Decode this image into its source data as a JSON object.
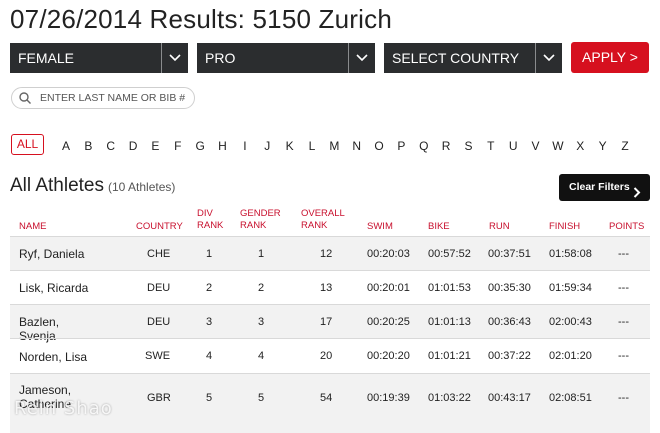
{
  "page_title": "07/26/2014 Results: 5150 Zurich",
  "filters": {
    "gender": "FEMALE",
    "division": "PRO",
    "country": "SELECT COUNTRY",
    "apply_label": "APPLY >"
  },
  "search": {
    "placeholder": "ENTER LAST NAME OR BIB #"
  },
  "alphabet": {
    "all_label": "ALL",
    "letters": [
      "A",
      "B",
      "C",
      "D",
      "E",
      "F",
      "G",
      "H",
      "I",
      "J",
      "K",
      "L",
      "M",
      "N",
      "O",
      "P",
      "Q",
      "R",
      "S",
      "T",
      "U",
      "V",
      "W",
      "X",
      "Y",
      "Z"
    ]
  },
  "section": {
    "title": "All Athletes",
    "count": "(10 Athletes)",
    "clear_label": "Clear Filters"
  },
  "table": {
    "headers": {
      "name": "NAME",
      "country": "COUNTRY",
      "div_rank": [
        "DIV",
        "RANK"
      ],
      "gender_rank": [
        "GENDER",
        "RANK"
      ],
      "overall_rank": [
        "OVERALL",
        "RANK"
      ],
      "swim": "SWIM",
      "bike": "BIKE",
      "run": "RUN",
      "finish": "FINISH",
      "points": "POINTS"
    },
    "rows": [
      {
        "name": "Ryf, Daniela",
        "country": "CHE",
        "div": "1",
        "gender": "1",
        "overall": "12",
        "swim": "00:20:03",
        "bike": "00:57:52",
        "run": "00:37:51",
        "finish": "01:58:08",
        "points": "---"
      },
      {
        "name": "Lisk, Ricarda",
        "country": "DEU",
        "div": "2",
        "gender": "2",
        "overall": "13",
        "swim": "00:20:01",
        "bike": "01:01:53",
        "run": "00:35:30",
        "finish": "01:59:34",
        "points": "---"
      },
      {
        "name": "Bazlen, Svenja",
        "country": "DEU",
        "div": "3",
        "gender": "3",
        "overall": "17",
        "swim": "00:20:25",
        "bike": "01:01:13",
        "run": "00:36:43",
        "finish": "02:00:43",
        "points": "---"
      },
      {
        "name": "Norden, Lisa",
        "country": "SWE",
        "div": "4",
        "gender": "4",
        "overall": "20",
        "swim": "00:20:20",
        "bike": "01:01:21",
        "run": "00:37:22",
        "finish": "02:01:20",
        "points": "---"
      },
      {
        "name": "Jameson, Catherine",
        "country": "GBR",
        "div": "5",
        "gender": "5",
        "overall": "54",
        "swim": "00:19:39",
        "bike": "01:03:22",
        "run": "00:43:17",
        "finish": "02:08:51",
        "points": "---"
      }
    ]
  },
  "watermark": "Rein Shao",
  "colors": {
    "accent": "#d6101f",
    "dark": "#2b2d2f"
  }
}
